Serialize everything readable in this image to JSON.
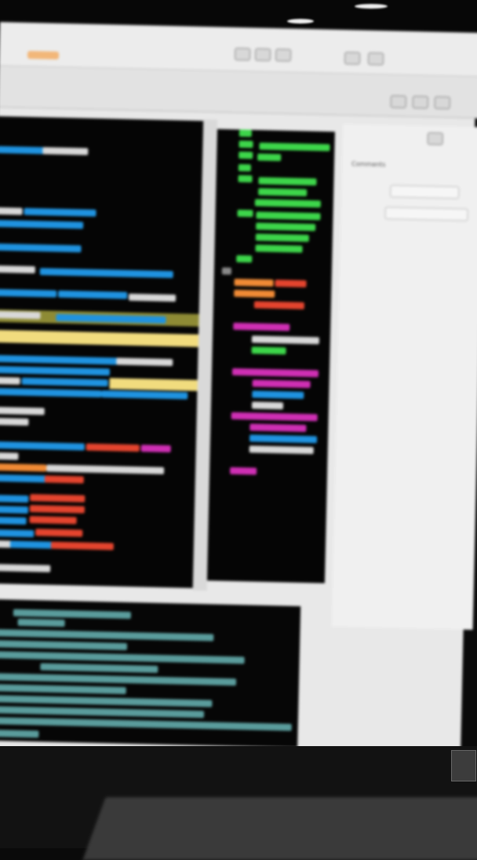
{
  "window": {
    "title": "",
    "toolbar": {
      "icons": [
        "file-icon",
        "edit-icon",
        "run-icon",
        "settings-icon"
      ]
    }
  },
  "editor": {
    "theme": "dark",
    "colors": {
      "keyword": "#1f93e0",
      "string": "#3dd64a",
      "number": "#f08a35",
      "error": "#e4442e",
      "tag": "#cf2fb4",
      "comment": "#5a9c9c",
      "highlight": "#f1dc7e"
    }
  },
  "side_panel": {
    "label": "Comments",
    "buttons": [
      "",
      ""
    ]
  },
  "console": {
    "lines": []
  }
}
